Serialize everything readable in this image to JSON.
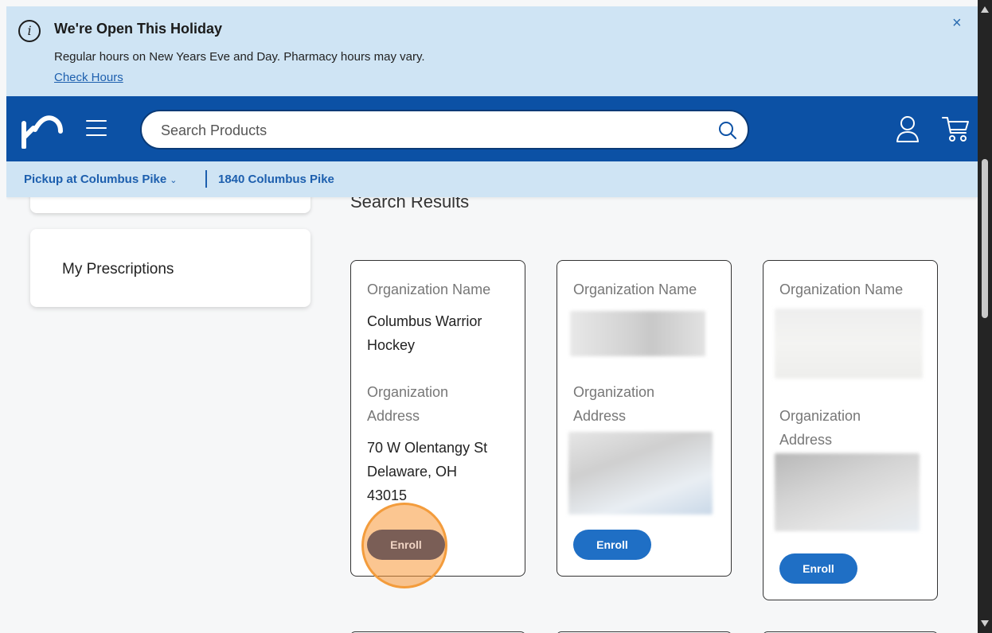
{
  "banner": {
    "title": "We're Open This Holiday",
    "message": "Regular hours on New Years Eve and Day. Pharmacy hours may vary.",
    "link": "Check Hours",
    "close": "×",
    "info_icon_text": "i"
  },
  "header": {
    "search_placeholder": "Search Products"
  },
  "store": {
    "pickup": "Pickup at Columbus Pike",
    "caret": "⌄",
    "address": "1840 Columbus Pike"
  },
  "sidebar": {
    "prescriptions": "My Prescriptions"
  },
  "results": {
    "title": "Search Results",
    "cards": [
      {
        "name_label": "Organization Name",
        "name_lines": [
          "Columbus Warrior",
          "Hockey"
        ],
        "address_label_lines": [
          "Organization",
          "Address"
        ],
        "address_lines": [
          "70 W Olentangy St",
          "Delaware, OH",
          "43015"
        ],
        "button": "Enroll"
      },
      {
        "name_label": "Organization Name",
        "address_label_lines": [
          "Organization",
          "Address"
        ],
        "button": "Enroll"
      },
      {
        "name_label": "Organization Name",
        "address_label_lines": [
          "Organization",
          "Address"
        ],
        "button": "Enroll"
      }
    ]
  },
  "colors": {
    "brand_blue": "#0c51a5",
    "banner_bg": "#cfe4f4",
    "enroll_blue": "#1f6fc5",
    "highlight_orange": "#f39c3c"
  }
}
